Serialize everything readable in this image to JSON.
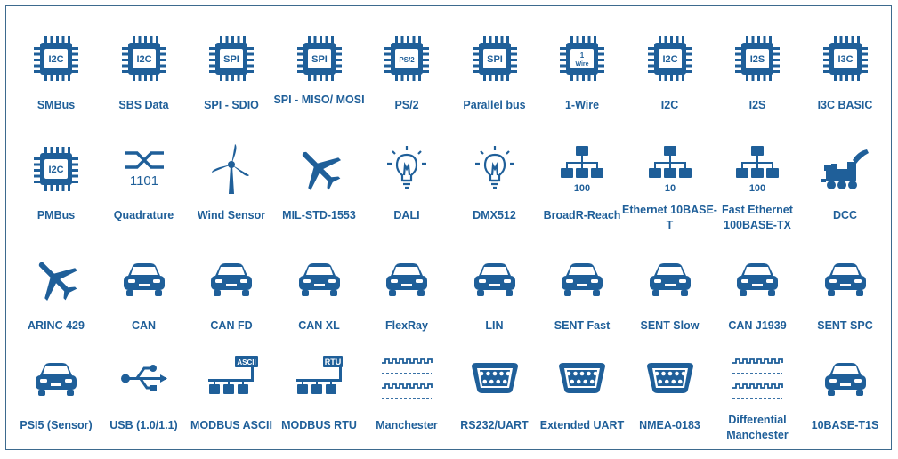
{
  "accent_color": "#1f5f99",
  "rows": [
    [
      {
        "label": "SMBus",
        "icon": "chip-icon",
        "chip_text": "I2C"
      },
      {
        "label": "SBS Data",
        "icon": "chip-icon",
        "chip_text": "I2C"
      },
      {
        "label": "SPI - SDIO",
        "icon": "chip-icon",
        "chip_text": "SPI"
      },
      {
        "label": "SPI - MISO/ MOSI",
        "icon": "chip-icon",
        "chip_text": "SPI"
      },
      {
        "label": "PS/2",
        "icon": "chip-icon",
        "chip_text": "PS/2"
      },
      {
        "label": "Parallel bus",
        "icon": "chip-icon",
        "chip_text": "SPI"
      },
      {
        "label": "1-Wire",
        "icon": "chip-icon",
        "chip_text": "1 Wire"
      },
      {
        "label": "I2C",
        "icon": "chip-icon",
        "chip_text": "I2C"
      },
      {
        "label": "I2S",
        "icon": "chip-icon",
        "chip_text": "I2S"
      },
      {
        "label": "I3C BASIC",
        "icon": "chip-icon",
        "chip_text": "I3C"
      }
    ],
    [
      {
        "label": "PMBus",
        "icon": "chip-icon",
        "chip_text": "I2C"
      },
      {
        "label": "Quadrature",
        "icon": "quadrature-icon",
        "chip_text": "1101"
      },
      {
        "label": "Wind Sensor",
        "icon": "wind-turbine-icon"
      },
      {
        "label": "MIL-STD-1553",
        "icon": "airplane-icon"
      },
      {
        "label": "DALI",
        "icon": "light-bulb-icon"
      },
      {
        "label": "DMX512",
        "icon": "light-bulb-icon"
      },
      {
        "label": "BroadR-Reach",
        "icon": "network-icon",
        "chip_text": "100"
      },
      {
        "label": "Ethernet 10BASE-T",
        "icon": "network-icon",
        "chip_text": "10"
      },
      {
        "label": "Fast Ethernet 100BASE-TX",
        "icon": "network-icon",
        "chip_text": "100"
      },
      {
        "label": "DCC",
        "icon": "model-train-icon"
      }
    ],
    [
      {
        "label": "ARINC 429",
        "icon": "airplane-icon"
      },
      {
        "label": "CAN",
        "icon": "car-icon"
      },
      {
        "label": "CAN FD",
        "icon": "car-icon"
      },
      {
        "label": "CAN XL",
        "icon": "car-icon"
      },
      {
        "label": "FlexRay",
        "icon": "car-icon"
      },
      {
        "label": "LIN",
        "icon": "car-icon"
      },
      {
        "label": "SENT Fast",
        "icon": "car-icon"
      },
      {
        "label": "SENT Slow",
        "icon": "car-icon"
      },
      {
        "label": "CAN J1939",
        "icon": "car-icon"
      },
      {
        "label": "SENT SPC",
        "icon": "car-icon"
      }
    ],
    [
      {
        "label": "PSI5 (Sensor)",
        "icon": "car-icon"
      },
      {
        "label": "USB (1.0/1.1)",
        "icon": "usb-icon"
      },
      {
        "label": "MODBUS ASCII",
        "icon": "modbus-icon",
        "chip_text": "ASCII"
      },
      {
        "label": "MODBUS RTU",
        "icon": "modbus-icon",
        "chip_text": "RTU"
      },
      {
        "label": "Manchester",
        "icon": "waveform-icon"
      },
      {
        "label": "RS232/UART",
        "icon": "db9-connector-icon"
      },
      {
        "label": "Extended UART",
        "icon": "db9-connector-icon"
      },
      {
        "label": "NMEA-0183",
        "icon": "db9-connector-icon"
      },
      {
        "label": "Differential Manchester",
        "icon": "waveform-icon"
      },
      {
        "label": "10BASE-T1S",
        "icon": "car-icon"
      }
    ]
  ]
}
